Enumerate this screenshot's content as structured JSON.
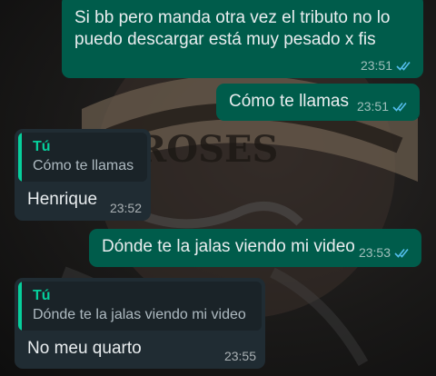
{
  "messages": [
    {
      "type": "outgoing",
      "text": "Si bb pero manda otra vez el tributo no lo\npuedo descargar está muy pesado x fis",
      "time": "23:51",
      "status": "read"
    },
    {
      "type": "outgoing",
      "text": "Cómo te llamas",
      "time": "23:51",
      "status": "read"
    },
    {
      "type": "incoming",
      "quote_author": "Tú",
      "quote_text": "Cómo te llamas",
      "text": "Henrique",
      "time": "23:52"
    },
    {
      "type": "outgoing",
      "text": "Dónde te la jalas viendo mi video",
      "time": "23:53",
      "status": "read"
    },
    {
      "type": "incoming",
      "quote_author": "Tú",
      "quote_text": "Dónde te la jalas viendo mi video",
      "text": "No meu quarto",
      "time": "23:55"
    }
  ],
  "wallpaper": {
    "description_icon": "guns-n-roses-logo-wallpaper"
  },
  "colors": {
    "outgoing_bubble": "#005c4b",
    "incoming_bubble": "#202c33",
    "quote_accent": "#06cf9c",
    "read_tick": "#53bdeb"
  }
}
